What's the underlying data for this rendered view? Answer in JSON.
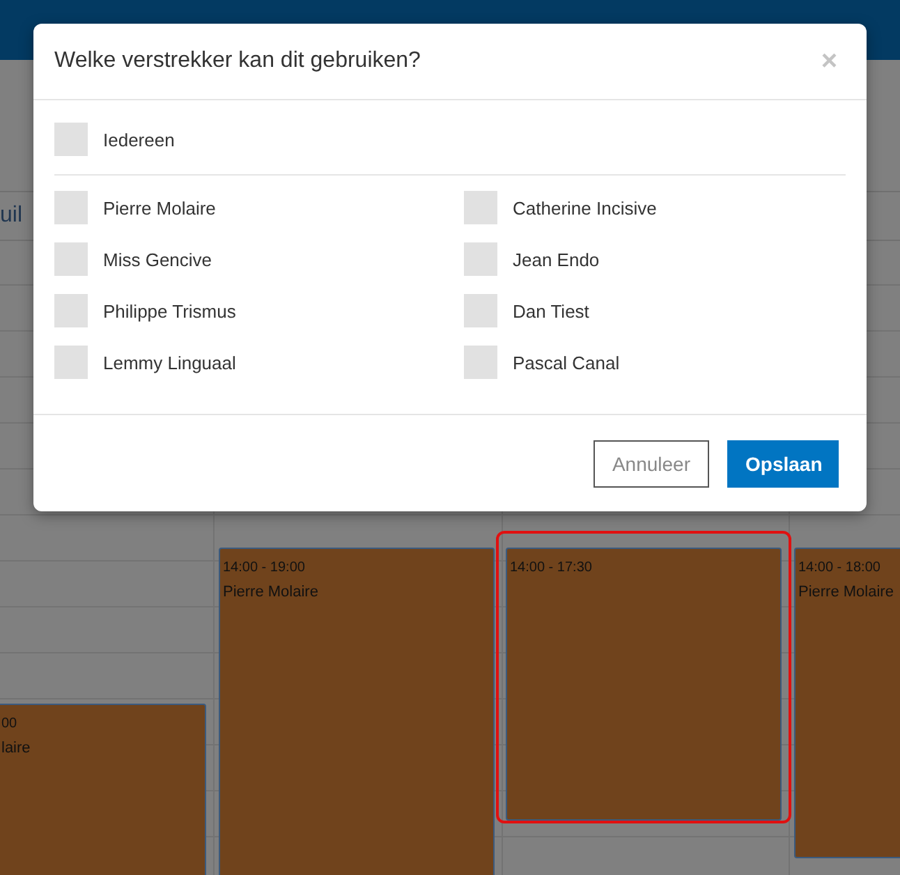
{
  "calendar": {
    "week_label": "uil",
    "events": [
      {
        "time": "00",
        "name": "laire",
        "selected": false
      },
      {
        "time": "14:00 - 19:00",
        "name": "Pierre Molaire",
        "selected": false
      },
      {
        "time": "14:00 - 17:30",
        "selected": true
      },
      {
        "time": "14:00 - 18:00",
        "name": "Pierre Molaire",
        "selected": false
      }
    ]
  },
  "dialog": {
    "title": "Welke verstrekker kan dit gebruiken?",
    "close": "×",
    "everyone": {
      "label": "Iedereen",
      "checked": false
    },
    "providers": [
      {
        "name": "Pierre Molaire",
        "checked": false
      },
      {
        "name": "Catherine Incisive",
        "checked": false
      },
      {
        "name": "Miss Gencive",
        "checked": false
      },
      {
        "name": "Jean Endo",
        "checked": false
      },
      {
        "name": "Philippe Trismus",
        "checked": false
      },
      {
        "name": "Dan Tiest",
        "checked": false
      },
      {
        "name": "Lemmy Linguaal",
        "checked": false
      },
      {
        "name": "Pascal Canal",
        "checked": false
      }
    ],
    "buttons": [
      {
        "label": "Annuleer",
        "kind": "secondary"
      },
      {
        "label": "Opslaan",
        "kind": "primary"
      }
    ]
  }
}
